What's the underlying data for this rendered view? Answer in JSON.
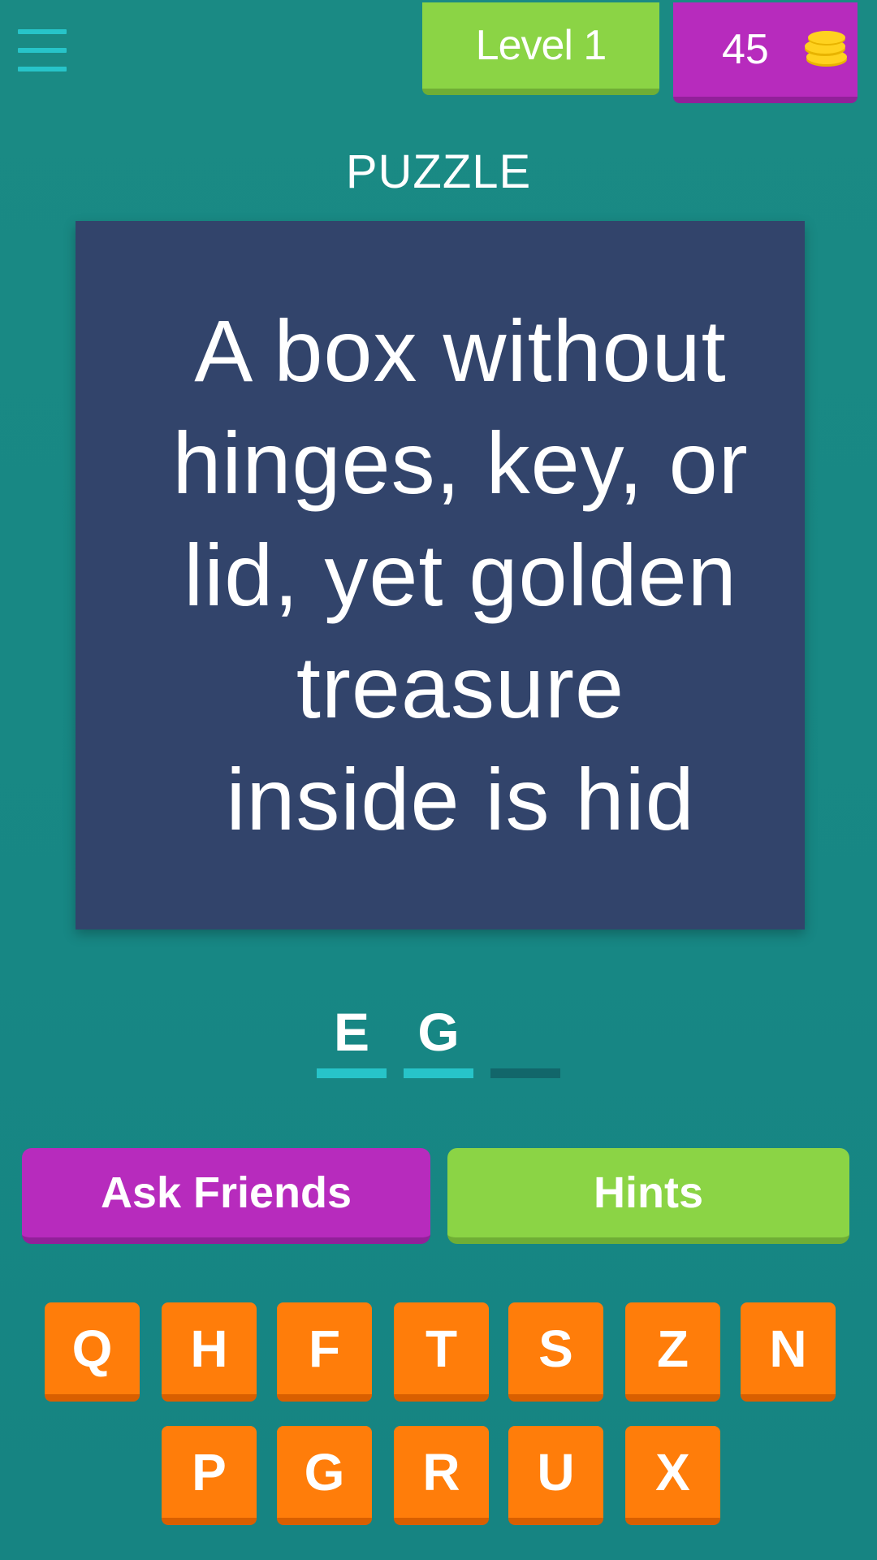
{
  "header": {
    "level_label": "Level 1",
    "coins": "45"
  },
  "puzzle": {
    "heading": "PUZZLE",
    "text": "A box without hinges, key, or lid, yet golden treasure inside is hid"
  },
  "answer": {
    "slots": [
      "E",
      "G",
      ""
    ]
  },
  "actions": {
    "ask_friends_label": "Ask Friends",
    "hints_label": "Hints"
  },
  "keyboard": {
    "row1": [
      "Q",
      "H",
      "F",
      "T",
      "S",
      "Z",
      "N"
    ],
    "row2": [
      "P",
      "G",
      "R",
      "U",
      "X"
    ]
  },
  "colors": {
    "background": "#178784",
    "card": "#32446b",
    "level_badge": "#8bd445",
    "coins_badge": "#b72bbd",
    "key": "#ff7d0a",
    "answer_line_filled": "#27c4c9",
    "answer_line_empty": "#12666a"
  }
}
